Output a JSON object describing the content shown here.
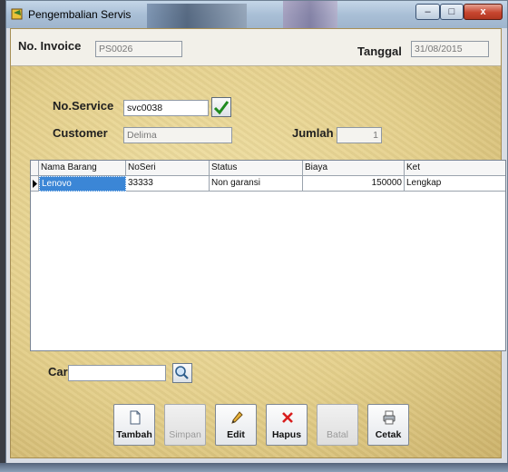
{
  "window": {
    "title": "Pengembalian Servis",
    "controls": {
      "minimize": "–",
      "maximize": "□",
      "close": "x"
    }
  },
  "header": {
    "invoice_label": "No. Invoice",
    "invoice_value": "PS0026",
    "date_label": "Tanggal",
    "date_value": "31/08/2015"
  },
  "service": {
    "no_service_label": "No.Service",
    "no_service_value": "svc0038",
    "customer_label": "Customer",
    "customer_value": "Delima",
    "jumlah_label": "Jumlah",
    "jumlah_value": "1"
  },
  "grid": {
    "columns": [
      "Nama Barang",
      "NoSeri",
      "Status",
      "Biaya",
      "Ket"
    ],
    "rows": [
      {
        "nama_barang": "Lenovo",
        "noseri": "33333",
        "status": "Non garansi",
        "biaya": "150000",
        "ket": "Lengkap"
      }
    ]
  },
  "search": {
    "label": "Cari",
    "value": ""
  },
  "toolbar": {
    "tambah": "Tambah",
    "simpan": "Simpan",
    "edit": "Edit",
    "hapus": "Hapus",
    "batal": "Batal",
    "cetak": "Cetak"
  },
  "colors": {
    "form_bg": "#e5d08b",
    "selection": "#3b86d6",
    "check_green": "#1f8a1f",
    "delete_red": "#d81e1e"
  }
}
